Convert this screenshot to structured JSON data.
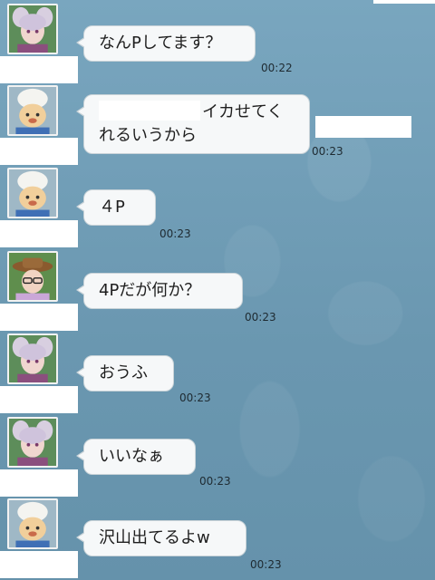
{
  "messages": [
    {
      "avatar": "bunny-avatar",
      "text": "なんPしてます？",
      "time": "00:22"
    },
    {
      "avatar": "chef-avatar",
      "text_line1": "イカせてく",
      "text_line2": "れるいうから",
      "time": "00:23"
    },
    {
      "avatar": "chef-avatar",
      "text": "４P",
      "time": "00:23"
    },
    {
      "avatar": "hat-avatar",
      "text": "4Pだが何か？",
      "time": "00:23"
    },
    {
      "avatar": "bunny-avatar",
      "text": "おうふ",
      "time": "00:23"
    },
    {
      "avatar": "bunny-avatar",
      "text": "いいなぁ",
      "time": "00:23"
    },
    {
      "avatar": "chef-avatar",
      "text": "沢山出てるよw",
      "time": "00:23"
    }
  ],
  "colors": {
    "background": "#6f9cb5",
    "bubble": "#f6f8f9",
    "bubble_border": "#c9d3d8",
    "time_text": "#1e2a31"
  }
}
